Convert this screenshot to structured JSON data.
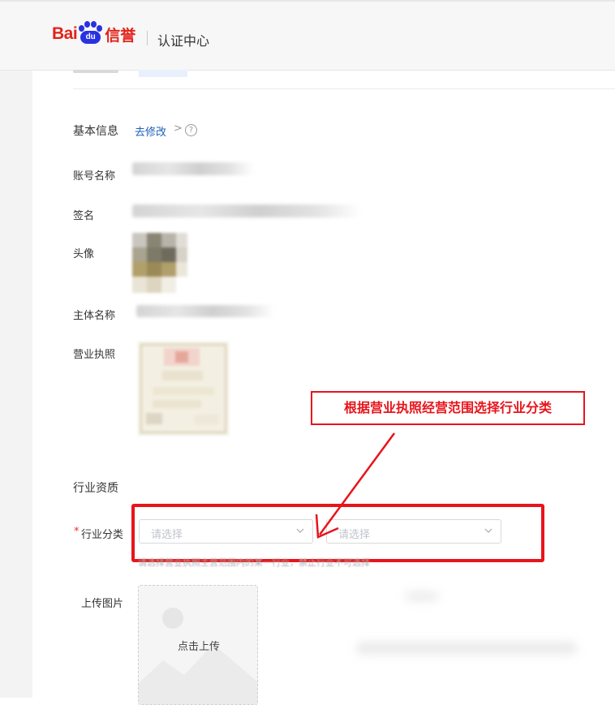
{
  "header": {
    "logo_text": "Bai",
    "logo_pad_text": "du",
    "logo_product": "信誉",
    "title": "认证中心"
  },
  "basic_info": {
    "title": "基本信息",
    "edit_link": "去修改",
    "edit_chevron": ">",
    "help_glyph": "?",
    "fields": {
      "account_name_label": "账号名称",
      "signature_label": "签名",
      "avatar_label": "头像",
      "entity_name_label": "主体名称",
      "business_license_label": "营业执照"
    }
  },
  "industry": {
    "section_title": "行业资质",
    "required_mark": "*",
    "category_label": "行业分类",
    "select_primary_placeholder": "请选择",
    "select_secondary_placeholder": "请选择",
    "hint": "请选择营业执照主营范围内的某一行业，禁止行业不可选择",
    "upload_label": "上传图片",
    "upload_text": "点击上传"
  },
  "annotation": {
    "callout_text": "根据营业执照经营范围选择行业分类",
    "color": "#e8141b"
  },
  "colors": {
    "link": "#1f5fb8",
    "required": "#e6352b",
    "logo_red": "#e2231a",
    "logo_blue": "#2932e1"
  }
}
